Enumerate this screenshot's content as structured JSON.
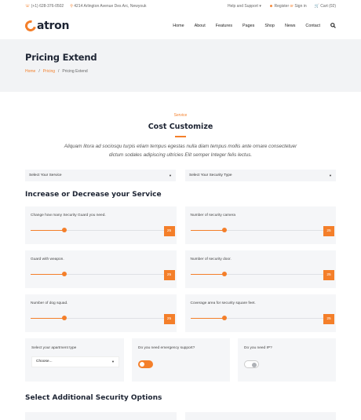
{
  "topbar": {
    "phone": "(+1) 628-376-0502",
    "address": "4214 Arlington Avenue Des Arc, Newyouk",
    "help": "Help and Support",
    "register": "Register",
    "or": "or",
    "signin": "Sign in",
    "cart": "Cart (02)"
  },
  "brand": {
    "name": "atron"
  },
  "nav": [
    "Home",
    "About",
    "Features",
    "Pages",
    "Shop",
    "News",
    "Contact"
  ],
  "hero": {
    "title": "Pricing Extend",
    "breadcrumb": [
      "Home",
      "Pricing",
      "Pricing Extend"
    ]
  },
  "intro": {
    "kicker": "Service",
    "title": "Cost Customize",
    "text": "Aliquam litora ad sociosqu turpis etiam tempus egestas nulla diam tempus mollis ante ornare consectetuer dictum sodales adipiscing ultricies Elit semper Integer felis lectus."
  },
  "selects": {
    "service": "Select Your Service",
    "security_type": "Select Your Security Type"
  },
  "section1_title": "Increase or Decrease your Service",
  "sliders": [
    {
      "label": "Change how many Security Guard you need.",
      "value": "25",
      "level": 0.25
    },
    {
      "label": "Number of security camera",
      "value": "25",
      "level": 0.25
    },
    {
      "label": "Guard with weapon.",
      "value": "25",
      "level": 0.25
    },
    {
      "label": "Number of security door.",
      "value": "25",
      "level": 0.25
    },
    {
      "label": "Number of dog squad.",
      "value": "25",
      "level": 0.25
    },
    {
      "label": "Coverage area for security square feet.",
      "value": "25",
      "level": 0.25
    }
  ],
  "apartment": {
    "label": "Select your apartment type",
    "selected": "Choose..."
  },
  "emergency": {
    "label": "Do you need emergency support?",
    "on": true
  },
  "ip": {
    "label": "Do you need IP?",
    "on": false
  },
  "section2_title": "Select Additional Security Options",
  "colors": {
    "accent": "#f47f2a",
    "dark": "#1d2433",
    "card": "#f5f6f8"
  }
}
